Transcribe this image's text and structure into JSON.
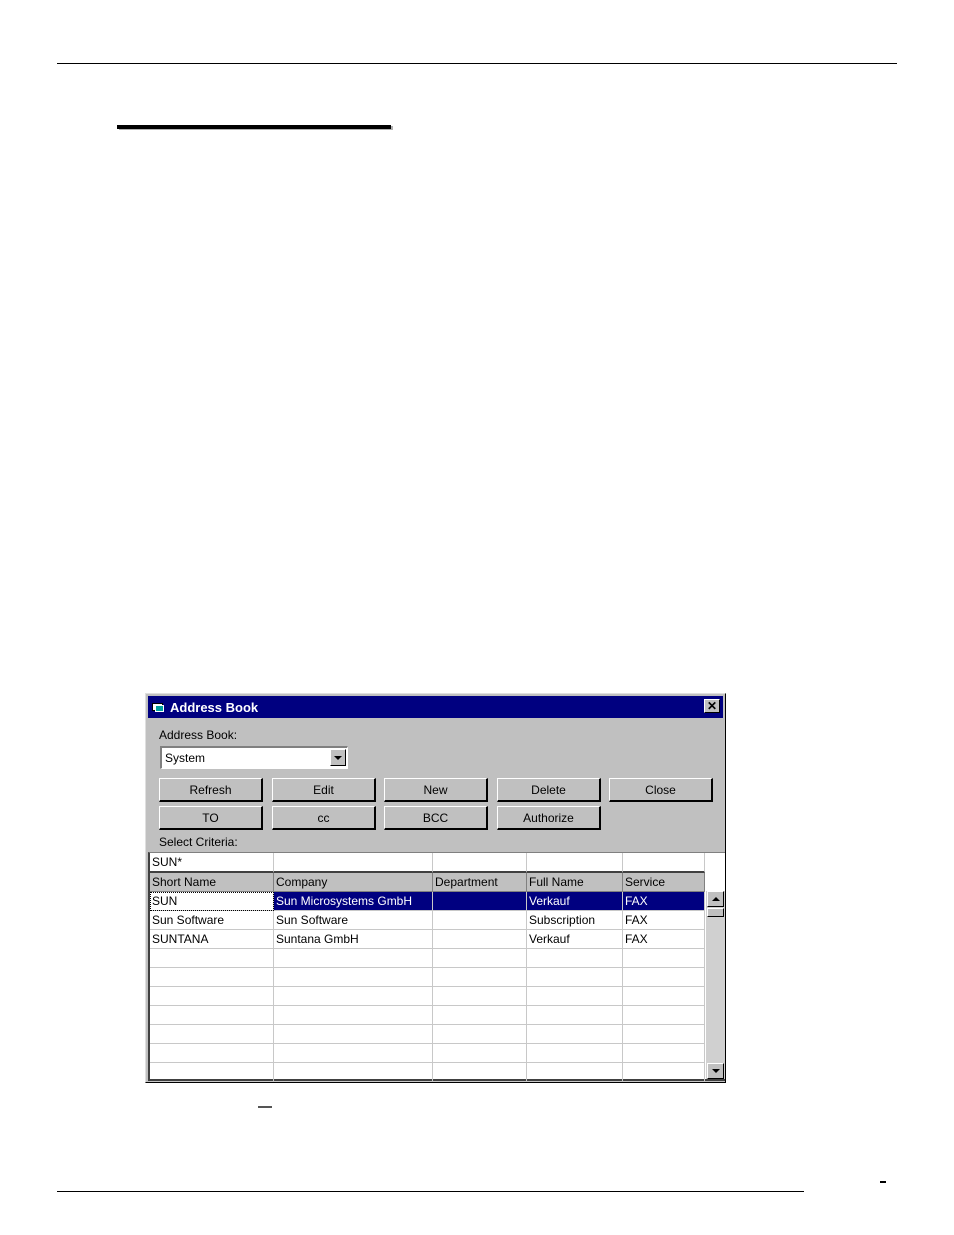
{
  "window": {
    "title": "Address Book",
    "close_glyph": "✕"
  },
  "form": {
    "address_book_label": "Address Book:",
    "address_book_value": "System",
    "select_criteria_label": "Select Criteria:"
  },
  "buttons": {
    "refresh": "Refresh",
    "edit": "Edit",
    "new": "New",
    "delete": "Delete",
    "close": "Close",
    "to": "TO",
    "cc": "cc",
    "bcc": "BCC",
    "authorize": "Authorize"
  },
  "grid": {
    "criteria": [
      "SUN*",
      "",
      "",
      "",
      ""
    ],
    "columns": [
      "Short Name",
      "Company",
      "Department",
      "Full Name",
      "Service"
    ],
    "rows": [
      [
        "SUN",
        "Sun Microsystems GmbH",
        "",
        "Verkauf",
        "FAX"
      ],
      [
        "Sun Software",
        "Sun Software",
        "",
        "Subscription",
        "FAX"
      ],
      [
        "SUNTANA",
        "Suntana GmbH",
        "",
        "Verkauf",
        "FAX"
      ],
      [
        "",
        "",
        "",
        "",
        ""
      ],
      [
        "",
        "",
        "",
        "",
        ""
      ],
      [
        "",
        "",
        "",
        "",
        ""
      ],
      [
        "",
        "",
        "",
        "",
        ""
      ],
      [
        "",
        "",
        "",
        "",
        ""
      ],
      [
        "",
        "",
        "",
        "",
        ""
      ],
      [
        "",
        "",
        "",
        "",
        ""
      ]
    ],
    "selected_row": 0
  },
  "icons": {
    "title": "address-book-icon",
    "close": "close-icon",
    "dropdown": "chevron-down-icon",
    "scroll_up": "arrow-up-icon",
    "scroll_down": "arrow-down-icon"
  }
}
